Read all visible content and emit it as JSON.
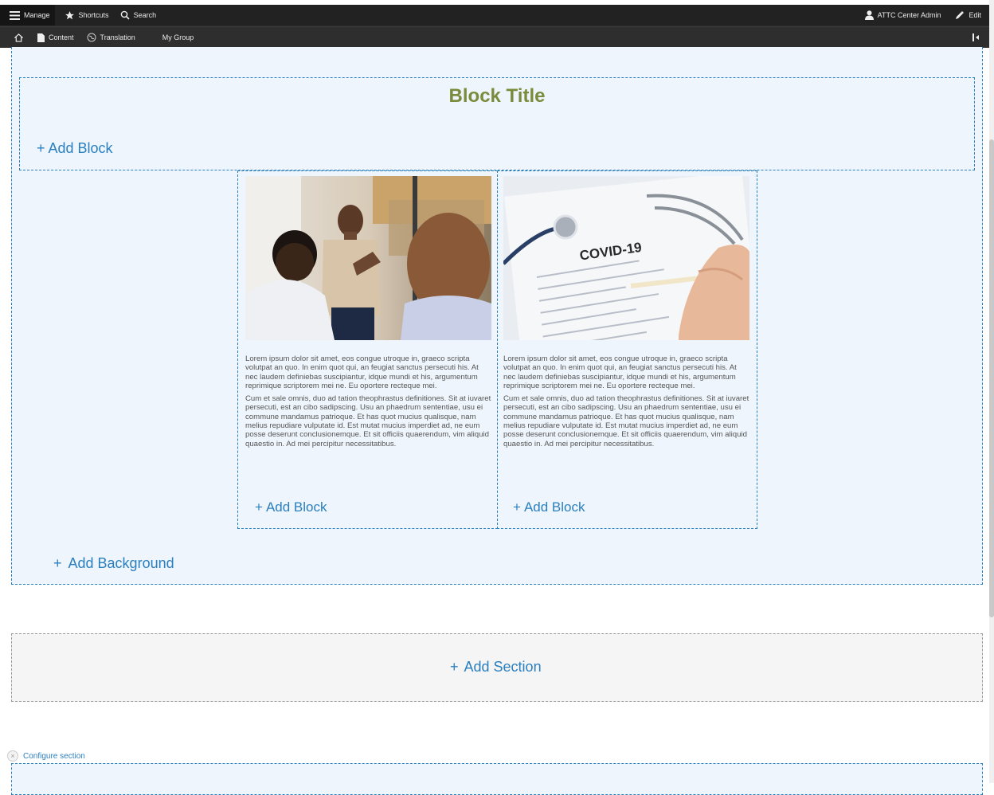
{
  "toolbar": {
    "manage": "Manage",
    "shortcuts": "Shortcuts",
    "search": "Search",
    "user": "ATTC Center Admin",
    "edit": "Edit",
    "content": "Content",
    "translation": "Translation",
    "my_group": "My Group"
  },
  "block_title": "Block Title",
  "add_block": "Add Block",
  "add_background": "Add Background",
  "add_section": "Add Section",
  "configure_section": "Configure section",
  "columns": [
    {
      "image": "meeting-photo",
      "para1": "Lorem ipsum dolor sit amet, eos congue utroque in, graeco scripta volutpat an quo. In enim quot qui, an feugiat sanctus persecuti his. At nec laudem definiebas suscipiantur, idque mundi et his, argumentum reprimique scriptorem mei ne. Eu oportere recteque mei.",
      "para2": "Cum et sale omnis, duo ad tation theophrastus definitiones. Sit at iuvaret persecuti, est an cibo sadipscing. Usu an phaedrum sententiae, usu ei commune mandamus patrioque. Et has quot mucius qualisque, nam melius repudiare vulputate id. Est mutat mucius imperdiet ad, ne eum posse deserunt conclusionemque. Et sit officiis quaerendum, vim aliquid quaestio in. Ad mei percipitur necessitatibus."
    },
    {
      "image": "covid-form-photo",
      "image_text": "COVID-19",
      "para1": "Lorem ipsum dolor sit amet, eos congue utroque in, graeco scripta volutpat an quo. In enim quot qui, an feugiat sanctus persecuti his. At nec laudem definiebas suscipiantur, idque mundi et his, argumentum reprimique scriptorem mei ne. Eu oportere recteque mei.",
      "para2": "Cum et sale omnis, duo ad tation theophrastus definitiones. Sit at iuvaret persecuti, est an cibo sadipscing. Usu an phaedrum sententiae, usu ei commune mandamus patrioque. Et has quot mucius qualisque, nam melius repudiare vulputate id. Est mutat mucius imperdiet ad, ne eum posse deserunt conclusionemque. Et sit officiis quaerendum, vim aliquid quaestio in. Ad mei percipitur necessitatibus."
    }
  ],
  "colors": {
    "accent": "#2a7fbf",
    "title": "#7a8c3c",
    "toolbar": "#2b2b2b",
    "section_bg": "#eef5fc"
  }
}
